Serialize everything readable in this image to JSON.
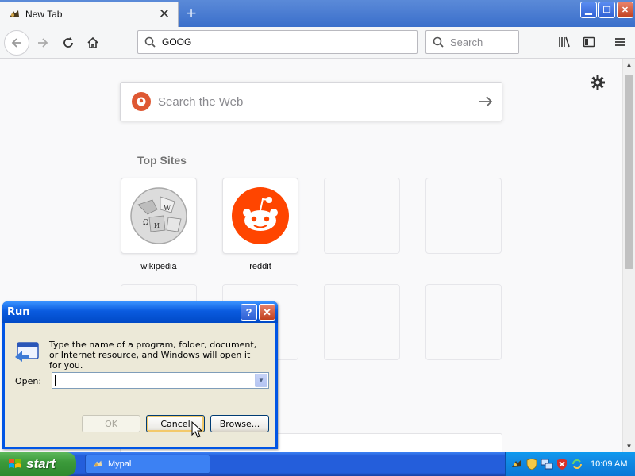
{
  "browser": {
    "tab": {
      "title": "New Tab"
    },
    "urlbar": {
      "value": "GOOG"
    },
    "searchbar": {
      "placeholder": "Search"
    }
  },
  "newtab": {
    "web_search_placeholder": "Search the Web",
    "top_sites_title": "Top Sites",
    "sites": [
      {
        "label": "wikipedia",
        "icon": "wikipedia-globe"
      },
      {
        "label": "reddit",
        "icon": "reddit-alien"
      }
    ]
  },
  "run_dialog": {
    "title": "Run",
    "description": "Type the name of a program, folder, document, or Internet resource, and Windows will open it for you.",
    "open_label": "Open:",
    "open_value": "",
    "ok_label": "OK",
    "cancel_label": "Cancel",
    "browse_label": "Browse..."
  },
  "taskbar": {
    "start_label": "start",
    "task_item": "Mypal",
    "clock": "10:09 AM"
  },
  "colors": {
    "xp_blue": "#245edb",
    "start_green": "#3c9a3b",
    "reddit_orange": "#ff4500",
    "ddg_orange": "#de5833"
  }
}
